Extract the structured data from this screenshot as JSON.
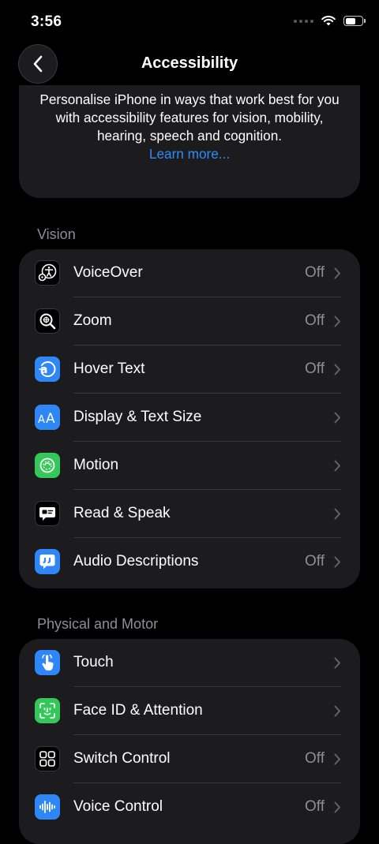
{
  "status": {
    "time": "3:56"
  },
  "nav": {
    "title": "Accessibility"
  },
  "intro": {
    "text": "Personalise iPhone in ways that work best for you with accessibility features for vision, mobility, hearing, speech and cognition.",
    "link": "Learn more..."
  },
  "sections": {
    "vision": {
      "header": "Vision",
      "rows": [
        {
          "label": "VoiceOver",
          "value": "Off",
          "icon": "voiceover-icon"
        },
        {
          "label": "Zoom",
          "value": "Off",
          "icon": "zoom-icon"
        },
        {
          "label": "Hover Text",
          "value": "Off",
          "icon": "hover-text-icon"
        },
        {
          "label": "Display & Text Size",
          "value": "",
          "icon": "display-text-size-icon"
        },
        {
          "label": "Motion",
          "value": "",
          "icon": "motion-icon"
        },
        {
          "label": "Read & Speak",
          "value": "",
          "icon": "read-speak-icon"
        },
        {
          "label": "Audio Descriptions",
          "value": "Off",
          "icon": "audio-descriptions-icon"
        }
      ]
    },
    "physical": {
      "header": "Physical and Motor",
      "rows": [
        {
          "label": "Touch",
          "value": "",
          "icon": "touch-icon"
        },
        {
          "label": "Face ID & Attention",
          "value": "",
          "icon": "face-id-icon"
        },
        {
          "label": "Switch Control",
          "value": "Off",
          "icon": "switch-control-icon"
        },
        {
          "label": "Voice Control",
          "value": "Off",
          "icon": "voice-control-icon"
        }
      ]
    }
  },
  "colors": {
    "background": "#000000",
    "card": "#1c1c1e",
    "link": "#2f8cf8",
    "secondary_text": "#8e8e93",
    "icon_blue": "#2f86f6",
    "icon_green": "#34c759"
  }
}
